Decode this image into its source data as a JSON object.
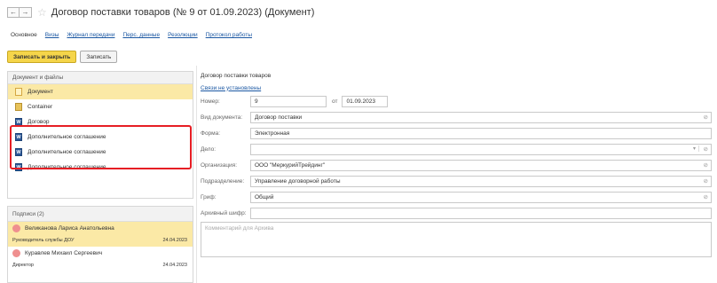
{
  "window": {
    "title": "Договор поставки товаров (№ 9 от 01.09.2023) (Документ)",
    "back_glyph": "←",
    "forward_glyph": "→",
    "favorite_glyph": "☆"
  },
  "tabs": [
    {
      "label": "Основное",
      "active": true
    },
    {
      "label": "Визы"
    },
    {
      "label": "Журнал передачи"
    },
    {
      "label": "Перс. данные"
    },
    {
      "label": "Резолюции"
    },
    {
      "label": "Протокол работы"
    }
  ],
  "toolbar": {
    "save_close_label": "Записать и закрыть",
    "save_label": "Записать"
  },
  "documents_panel": {
    "header": "Документ и файлы",
    "items": [
      {
        "label": "Документ",
        "icon": "document-icon",
        "glyph": ""
      },
      {
        "label": "Container",
        "icon": "folder-icon",
        "glyph": ""
      },
      {
        "label": "Договор",
        "icon": "word-icon",
        "glyph": "W"
      },
      {
        "label": "Дополнительное соглашение",
        "icon": "word-icon",
        "glyph": "W"
      },
      {
        "label": "Дополнительное соглашение",
        "icon": "word-icon",
        "glyph": "W"
      },
      {
        "label": "Дополнительное соглашение",
        "icon": "word-icon",
        "glyph": "W"
      }
    ]
  },
  "signatures_panel": {
    "header": "Подписи (2)",
    "items": [
      {
        "name": "Великанова Лариса Анатольевна",
        "role": "Руководитель службы ДОУ",
        "date": "24.04.2023"
      },
      {
        "name": "Куравлев Михаил Сергеевич",
        "role": "Директор",
        "date": "24.04.2023"
      }
    ]
  },
  "form": {
    "doc_title": "Договор поставки товаров",
    "link_label": "Связи не установлены",
    "number_label": "Номер:",
    "number_value": "9",
    "date_prefix": "от",
    "date_value": "01.09.2023",
    "doc_type_label": "Вид документа:",
    "doc_type_value": "Договор поставки",
    "form_label": "Форма:",
    "form_value": "Электронная",
    "case_label": "Дело:",
    "case_value": "",
    "org_label": "Организация:",
    "org_value": "ООО \"МеркурийТрейдинг\"",
    "dept_label": "Подразделение:",
    "dept_value": "Управление договорной работы",
    "grif_label": "Гриф:",
    "grif_value": "Общий",
    "archive_label": "Архивный шифр:",
    "archive_value": "",
    "comment_placeholder": "Комментарий для Архива",
    "open_glyph": "⊘",
    "dropdown_glyph": "▾"
  },
  "colors": {
    "primary_button": "#f5d54a",
    "selection": "#fbe9a6",
    "link": "#1c58a3",
    "highlight_frame": "#e61e24"
  }
}
